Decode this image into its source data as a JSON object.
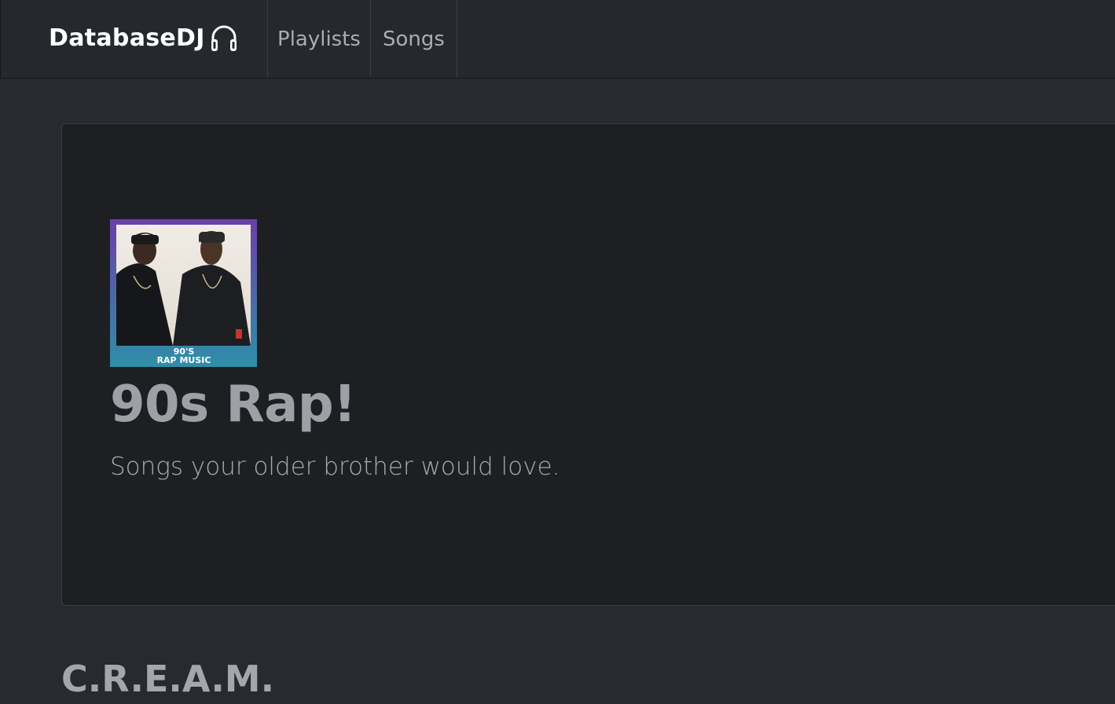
{
  "navbar": {
    "brand": "DatabaseDJ",
    "brand_icon": "headphones-icon",
    "links": [
      {
        "label": "Playlists"
      },
      {
        "label": "Songs"
      }
    ]
  },
  "playlist": {
    "title": "90s Rap!",
    "description": "Songs your older brother would love.",
    "cover": {
      "caption_line1": "90'S",
      "caption_line2": "RAP MUSIC"
    }
  },
  "songs": [
    {
      "title": "C.R.E.A.M."
    }
  ],
  "colors": {
    "page_bg": "#272a30",
    "navbar_bg": "#25282d",
    "card_bg": "#1e1f23",
    "cover_top": "#6b3fa8",
    "cover_bottom": "#2e8fa8"
  }
}
